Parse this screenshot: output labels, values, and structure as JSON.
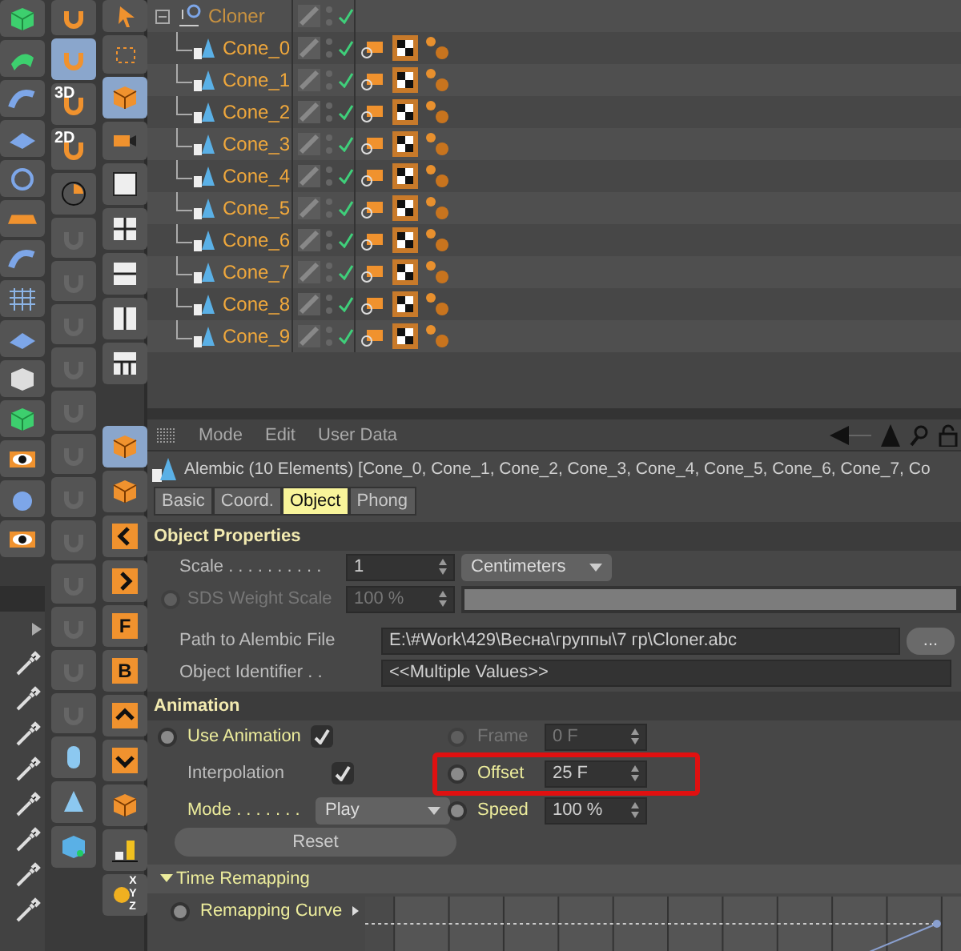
{
  "toolbar": {
    "magnet_3d": "3D",
    "magnet_2d": "2D",
    "front_view": "F",
    "back_view": "B",
    "axis_letters": [
      "X",
      "Y",
      "Z"
    ]
  },
  "object_manager": {
    "root": {
      "name": "Cloner",
      "expanded": true,
      "enabled": true,
      "children": [
        {
          "name": "Cone_0",
          "enabled": true
        },
        {
          "name": "Cone_1",
          "enabled": true
        },
        {
          "name": "Cone_2",
          "enabled": true
        },
        {
          "name": "Cone_3",
          "enabled": true
        },
        {
          "name": "Cone_4",
          "enabled": true
        },
        {
          "name": "Cone_5",
          "enabled": true
        },
        {
          "name": "Cone_6",
          "enabled": true
        },
        {
          "name": "Cone_7",
          "enabled": true
        },
        {
          "name": "Cone_8",
          "enabled": true
        },
        {
          "name": "Cone_9",
          "enabled": true
        }
      ]
    }
  },
  "attributes": {
    "menu": [
      "Mode",
      "Edit",
      "User Data"
    ],
    "title": "Alembic (10 Elements) [Cone_0, Cone_1, Cone_2, Cone_3, Cone_4, Cone_5, Cone_6, Cone_7, Co",
    "tabs": [
      {
        "label": "Basic",
        "selected": false
      },
      {
        "label": "Coord.",
        "selected": false
      },
      {
        "label": "Object",
        "selected": true
      },
      {
        "label": "Phong",
        "selected": false
      }
    ],
    "object_properties": {
      "title": "Object Properties",
      "scale": {
        "label": "Scale . . . . . . . . . .",
        "value": "1",
        "unit": "Centimeters"
      },
      "sds_weight_scale": {
        "label": "SDS Weight Scale",
        "value": "100 %",
        "disabled": true,
        "level": 1
      },
      "path": {
        "label": "Path to Alembic File",
        "value": "E:\\#Work\\429\\Весна\\группы\\7 гр\\Cloner.abc",
        "button": "..."
      },
      "object_identifier": {
        "label": "Object Identifier . .",
        "value": "<<Multiple Values>>"
      }
    },
    "animation": {
      "title": "Animation",
      "use_animation": {
        "label": "Use Animation",
        "checked": true,
        "highlighted": true
      },
      "interpolation": {
        "label": "Interpolation",
        "checked": true,
        "highlighted": false
      },
      "mode": {
        "label": "Mode . . . . . . .",
        "value": "Play",
        "highlighted": true
      },
      "frame": {
        "label": "Frame",
        "value": "0 F",
        "disabled": true
      },
      "offset": {
        "label": "Offset",
        "value": "25 F",
        "marked": true
      },
      "speed": {
        "label": "Speed",
        "value": "100 %"
      },
      "reset": "Reset"
    },
    "time_remapping": {
      "title": "Time Remapping",
      "expanded": true,
      "curve_label": "Remapping Curve"
    }
  }
}
